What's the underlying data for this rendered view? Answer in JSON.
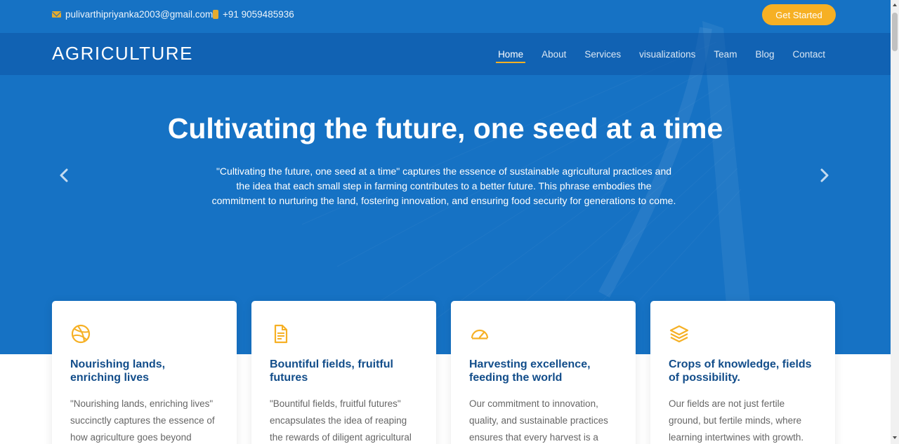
{
  "topbar": {
    "email": "pulivarthipriyanka2003@gmail.com",
    "phone": "+91 9059485936",
    "cta_label": "Get Started"
  },
  "navbar": {
    "logo": "AGRICULTURE",
    "items": [
      {
        "label": "Home",
        "active": true
      },
      {
        "label": "About"
      },
      {
        "label": "Services"
      },
      {
        "label": "visualizations"
      },
      {
        "label": "Team"
      },
      {
        "label": "Blog"
      },
      {
        "label": "Contact"
      }
    ]
  },
  "hero": {
    "title": "Cultivating the future, one seed at a time",
    "text": "\"Cultivating the future, one seed at a time\" captures the essence of sustainable agricultural practices and the idea that each small step in farming contributes to a better future. This phrase embodies the commitment to nurturing the land, fostering innovation, and ensuring food security for generations to come."
  },
  "cards": [
    {
      "icon": "dribbble-icon",
      "title": "Nourishing lands, enriching lives",
      "text": "\"Nourishing lands, enriching lives\" succinctly captures the essence of how agriculture goes beyond"
    },
    {
      "icon": "document-icon",
      "title": "Bountiful fields, fruitful futures",
      "text": "\"Bountiful fields, fruitful futures\" encapsulates the idea of reaping the rewards of diligent agricultural"
    },
    {
      "icon": "speedometer-icon",
      "title": "Harvesting excellence, feeding the world",
      "text": "Our commitment to innovation, quality, and sustainable practices ensures that every harvest is a"
    },
    {
      "icon": "layers-icon",
      "title": "Crops of knowledge, fields of possibility.",
      "text": "Our fields are not just fertile ground, but fertile minds, where learning intertwines with growth."
    }
  ],
  "colors": {
    "hero_bg": "#1672c4",
    "accent": "#f6b024",
    "card_title": "#124d8a",
    "card_text": "#666666"
  }
}
